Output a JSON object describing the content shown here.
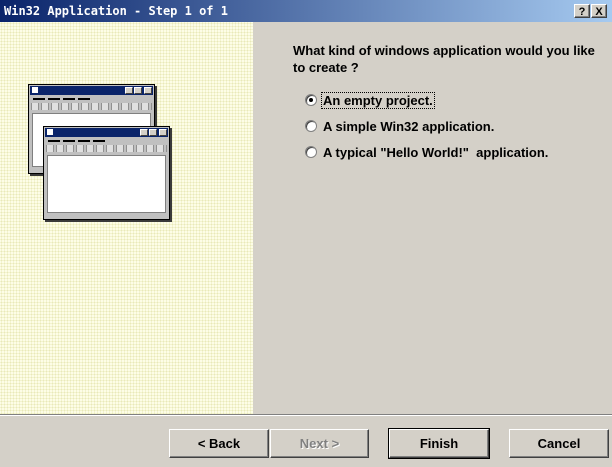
{
  "window": {
    "title": "Win32 Application - Step 1 of 1",
    "help_label": "?",
    "close_label": "X"
  },
  "question": "What kind of windows application would you like to create ?",
  "options": [
    {
      "label": "An empty project.",
      "checked": true
    },
    {
      "label": "A simple Win32 application.",
      "checked": false
    },
    {
      "label": "A typical \"Hello World!\"  application.",
      "checked": false
    }
  ],
  "buttons": {
    "back": "< Back",
    "next": "Next >",
    "finish": "Finish",
    "cancel": "Cancel"
  },
  "colors": {
    "titlebar_start": "#0a246a",
    "titlebar_end": "#a6caf0",
    "panel_bg": "#fdfde6",
    "dialog_bg": "#d4d0c8"
  }
}
